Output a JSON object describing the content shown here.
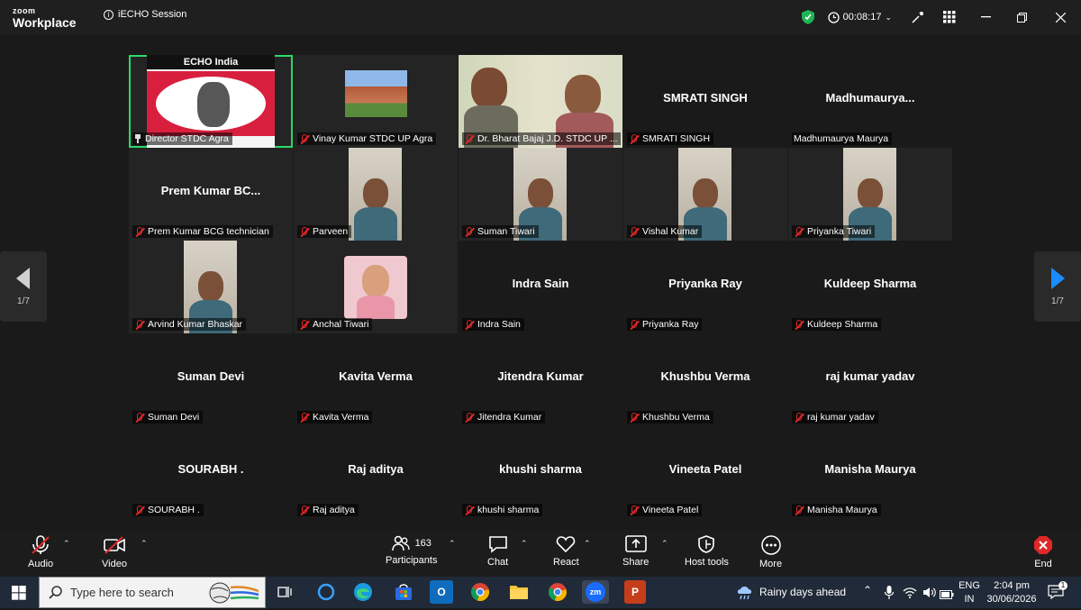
{
  "app": {
    "brand_top": "zoom",
    "brand_bottom": "Workplace",
    "session_title": "iECHO Session",
    "timer": "00:08:17"
  },
  "grid": {
    "tiles": [
      {
        "label": "Director STDC Agra",
        "icon": "pin-icon",
        "kind": "video-logo",
        "logo_title": "ECHO India"
      },
      {
        "label": "Vinay Kumar STDC UP Agra",
        "icon": "mic-off-icon",
        "kind": "video-building"
      },
      {
        "label": "Dr. Bharat Bajaj J.D. STDC UP ...",
        "icon": "mic-off-icon",
        "kind": "video-people"
      },
      {
        "label": "SMRATI SINGH",
        "icon": "mic-off-icon",
        "kind": "name",
        "name": "SMRATI SINGH"
      },
      {
        "label": "Madhumaurya Maurya",
        "icon": "none",
        "kind": "name",
        "name": "Madhumaurya..."
      },
      {
        "label": "Prem Kumar BCG technician",
        "icon": "mic-off-icon",
        "kind": "name",
        "name": "Prem Kumar BC..."
      },
      {
        "label": "Parveen",
        "icon": "mic-off-icon",
        "kind": "video-portrait"
      },
      {
        "label": "Suman Tiwari",
        "icon": "mic-off-icon",
        "kind": "video-portrait"
      },
      {
        "label": "Vishal Kumar",
        "icon": "mic-off-icon",
        "kind": "video-portrait"
      },
      {
        "label": "Priyanka Tiwari",
        "icon": "mic-off-icon",
        "kind": "video-portrait"
      },
      {
        "label": "Arvind Kumar Bhaskar",
        "icon": "mic-off-icon",
        "kind": "video-portrait"
      },
      {
        "label": "Anchal Tiwari",
        "icon": "mic-off-icon",
        "kind": "avatar"
      },
      {
        "label": "Indra Sain",
        "icon": "mic-off-icon",
        "kind": "name",
        "name": "Indra Sain"
      },
      {
        "label": "Priyanka Ray",
        "icon": "mic-off-icon",
        "kind": "name",
        "name": "Priyanka Ray"
      },
      {
        "label": "Kuldeep Sharma",
        "icon": "mic-off-icon",
        "kind": "name",
        "name": "Kuldeep Sharma"
      },
      {
        "label": "Suman Devi",
        "icon": "mic-off-icon",
        "kind": "name",
        "name": "Suman Devi"
      },
      {
        "label": "Kavita Verma",
        "icon": "mic-off-icon",
        "kind": "name",
        "name": "Kavita Verma"
      },
      {
        "label": "Jitendra Kumar",
        "icon": "mic-off-icon",
        "kind": "name",
        "name": "Jitendra Kumar"
      },
      {
        "label": "Khushbu Verma",
        "icon": "mic-off-icon",
        "kind": "name",
        "name": "Khushbu Verma"
      },
      {
        "label": "raj kumar yadav",
        "icon": "mic-off-icon",
        "kind": "name",
        "name": "raj kumar yadav"
      },
      {
        "label": "SOURABH .",
        "icon": "mic-off-icon",
        "kind": "name",
        "name": "SOURABH ."
      },
      {
        "label": "Raj aditya",
        "icon": "mic-off-icon",
        "kind": "name",
        "name": "Raj aditya"
      },
      {
        "label": "khushi sharma",
        "icon": "mic-off-icon",
        "kind": "name",
        "name": "khushi sharma"
      },
      {
        "label": "Vineeta Patel",
        "icon": "mic-off-icon",
        "kind": "name",
        "name": "Vineeta Patel"
      },
      {
        "label": "Manisha Maurya",
        "icon": "mic-off-icon",
        "kind": "name",
        "name": "Manisha Maurya"
      }
    ]
  },
  "pager": {
    "left_page": "1/7",
    "right_page": "1/7"
  },
  "toolbar": {
    "audio": "Audio",
    "video": "Video",
    "participants": "Participants",
    "participants_count": "163",
    "chat": "Chat",
    "react": "React",
    "share": "Share",
    "host_tools": "Host tools",
    "more": "More",
    "end": "End"
  },
  "taskbar": {
    "search_placeholder": "Type here to search",
    "weather": "Rainy days ahead",
    "lang_top": "ENG",
    "lang_bottom": "IN",
    "time": "2:04 pm",
    "date": "30/06/2026",
    "notification_count": "1"
  },
  "colors": {
    "active_speaker": "#2bd96b",
    "end_red": "#e02828",
    "pager_arrow_blue": "#1a8cff",
    "shield_green": "#1fb555"
  }
}
